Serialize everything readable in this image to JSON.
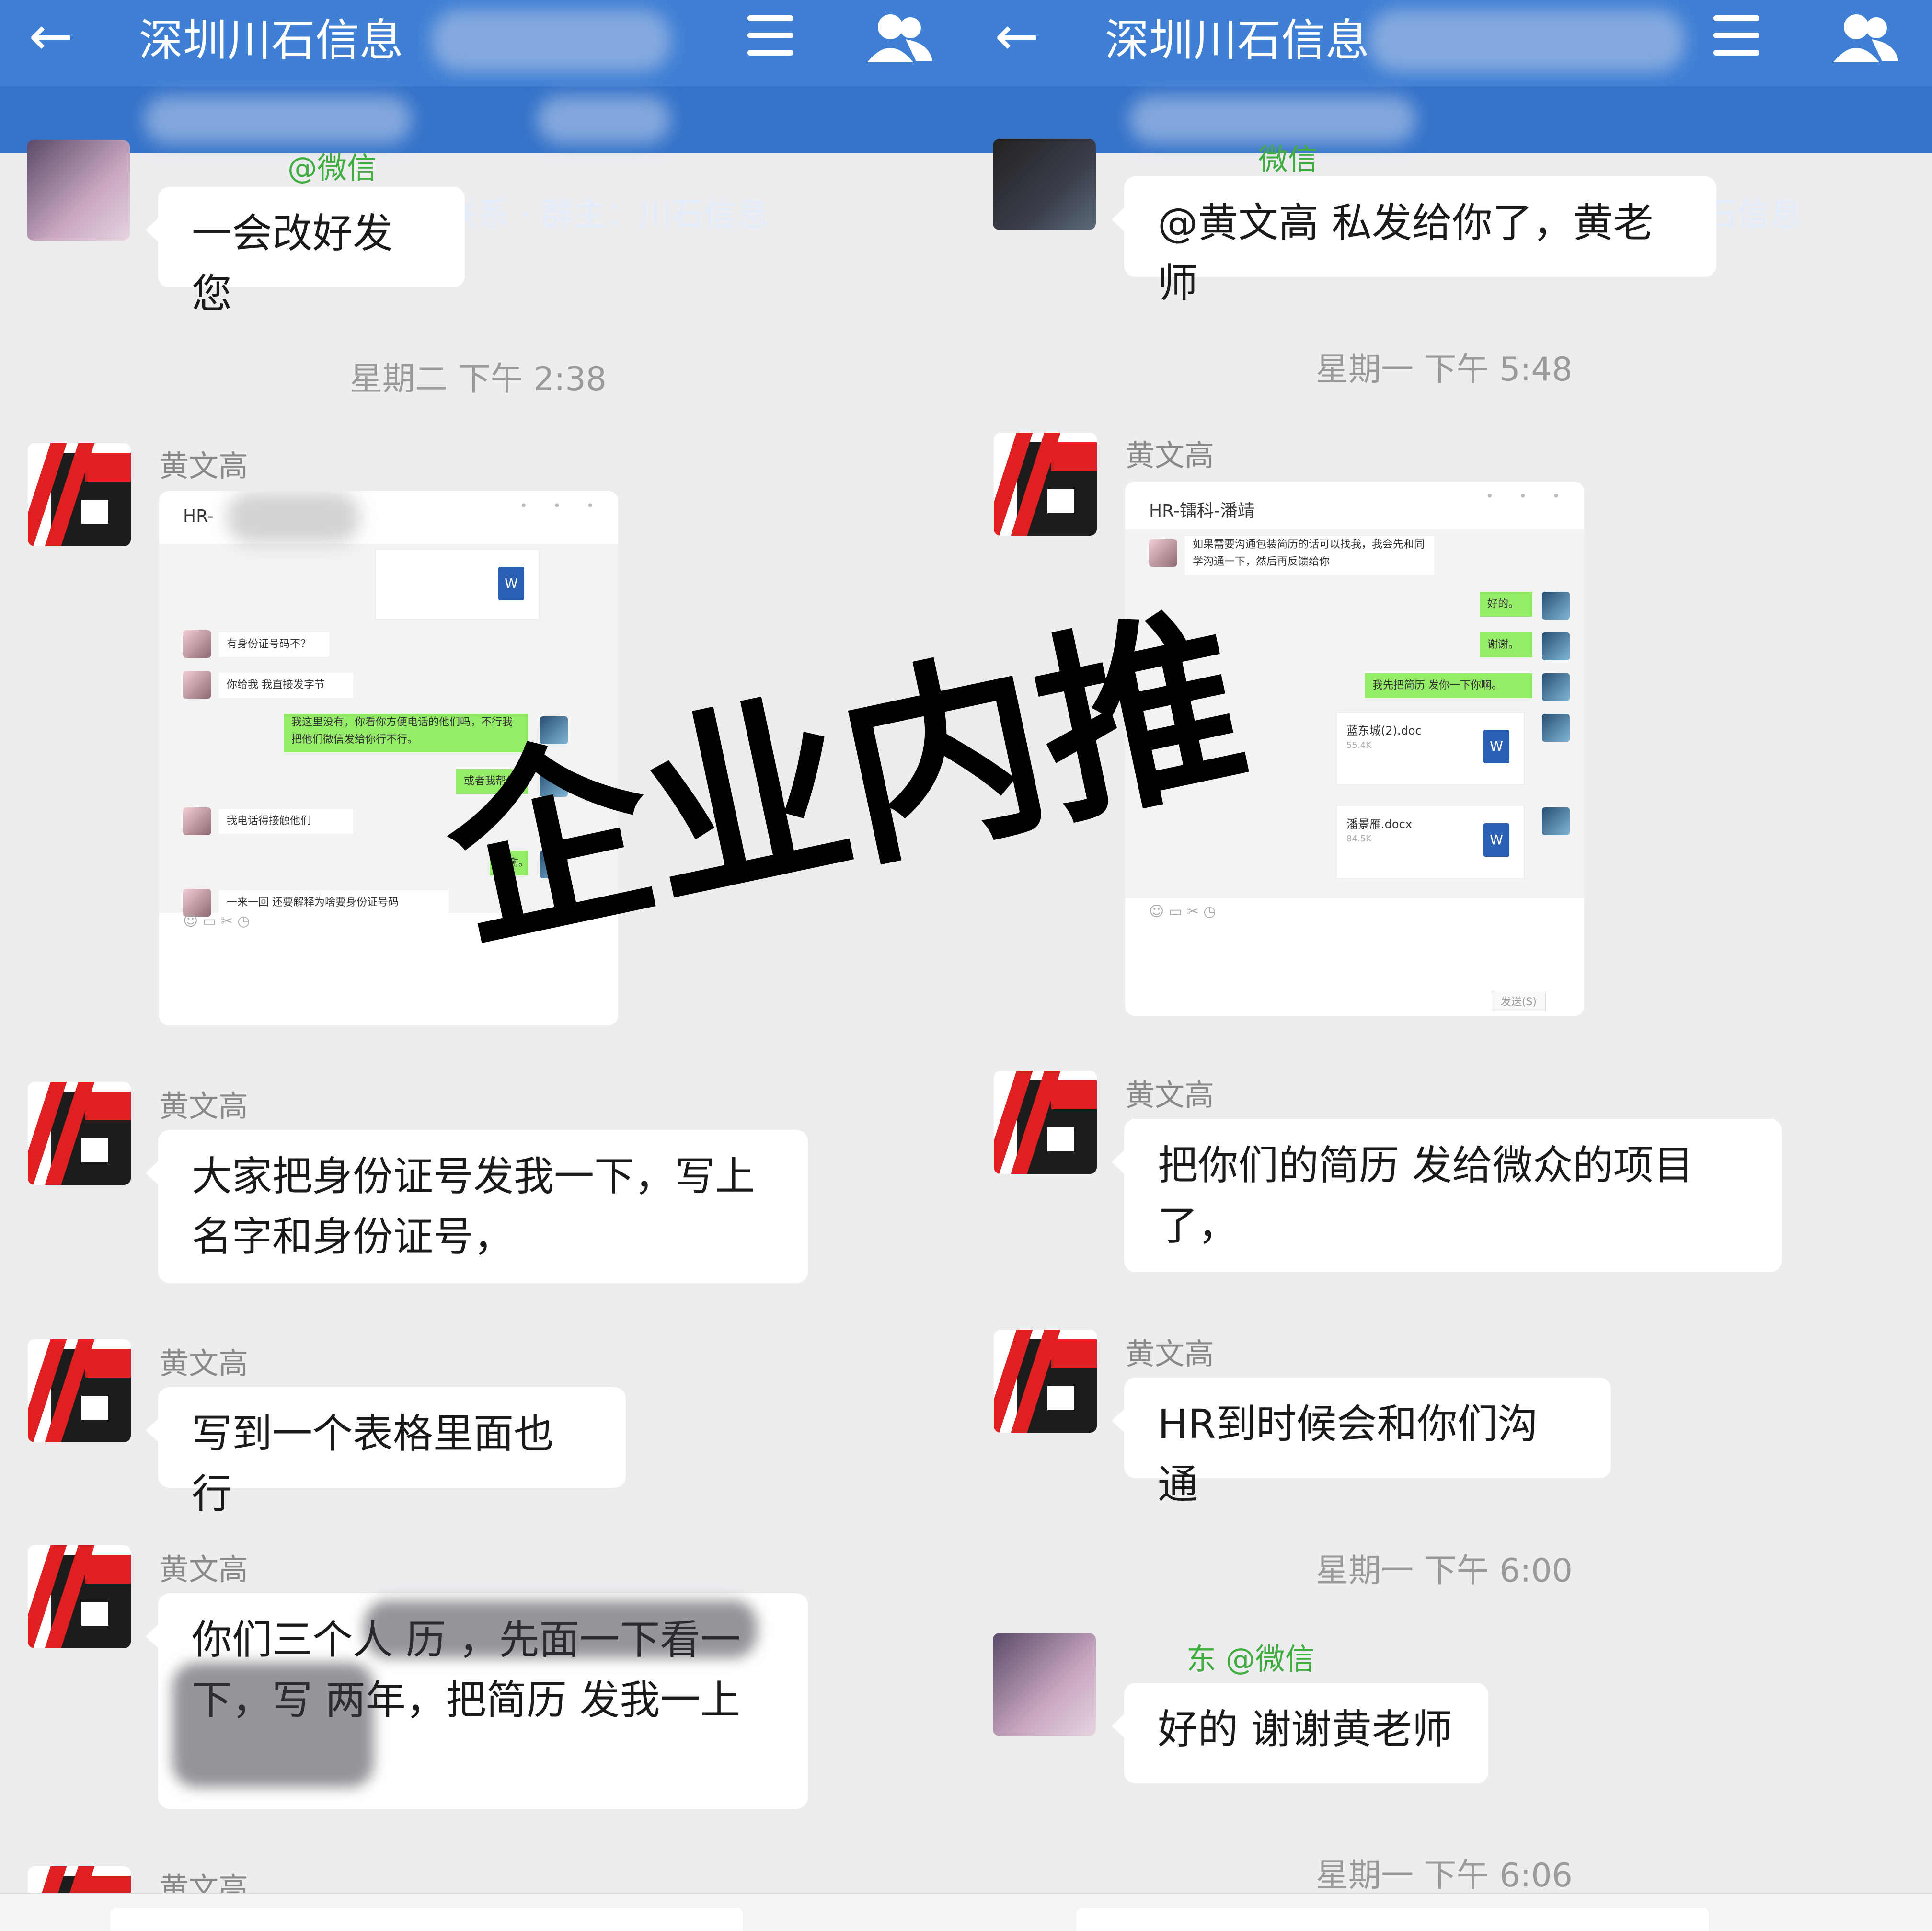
{
  "left": {
    "header": {
      "title": "深圳川石信息",
      "sub": "部联系 · 群主：川石信息"
    },
    "top_partial": {
      "name": "@微信",
      "text": "一会改好发您"
    },
    "time1": "星期二 下午 2:38",
    "sender": "黄文高",
    "shot": {
      "title": "HR-",
      "rows": [
        "有身份证号码不？",
        "你给我 我直接发字节",
        "我这里没有，你看你方便电话的他们吗，不行我把他们微信发给你行不行。",
        "或者我帮你要到",
        "我电话得接触他们",
        "谢谢。",
        "一来一回 还要解释为啥要身份证号码"
      ]
    },
    "msg2": "大家把身份证号发我一下，写上名字和身份证号，",
    "msg3": "写到一个表格里面也行",
    "msg4": "你们三个人 历 ，先面一下看一下，写 两年，把简历 发我一上",
    "bottom_name": "黄文高"
  },
  "right": {
    "header": {
      "title": "深圳川石信息",
      "sub": "联系人 · 群主：川石信息"
    },
    "top_partial": {
      "name": "微信",
      "text": "@黄文高 私发给你了，黄老师"
    },
    "time1": "星期一 下午 5:48",
    "sender": "黄文高",
    "shot": {
      "title": "HR-镭科-潘靖",
      "rows": [
        "如果需要沟通包装简历的话可以找我，我会先和同学沟通一下，然后再反馈给你",
        "好的。",
        "谢谢。",
        "我先把简历 发你一下你啊。"
      ],
      "files": [
        {
          "name": "蓝东城(2).doc",
          "size": "55.4K"
        },
        {
          "name": "潘景雁.docx",
          "size": "84.5K"
        }
      ],
      "send": "发送(S)"
    },
    "msg2": "把你们的简历 发给微众的项目了，",
    "msg3": "HR到时候会和你们沟通",
    "time2": "星期一 下午 6:00",
    "reply": {
      "name": "东 @微信",
      "text": "好的  谢谢黄老师"
    },
    "time3": "星期一 下午 6:06"
  },
  "icons": {
    "back": "←",
    "menu": "menu-icon",
    "group": "group-icon",
    "file": "W"
  },
  "watermark": "企业内推",
  "colors": {
    "header": "#3f7fd4",
    "subheader": "#3573c9",
    "bg": "#ededf0",
    "bubble": "#ffffff",
    "green": "#95ec69",
    "logo_red": "#e02020"
  }
}
